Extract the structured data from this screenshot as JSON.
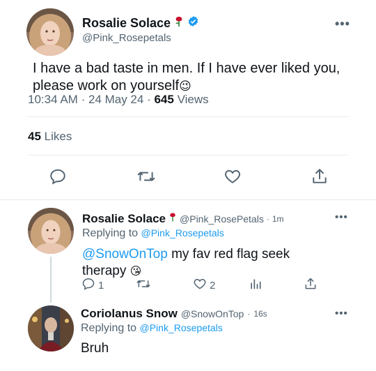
{
  "main_tweet": {
    "display_name": "Rosalie Solace",
    "handle": "@Pink_Rosepetals",
    "text": "I have a bad taste in men. If I have ever liked you, please work on yourself",
    "text_emoji": "😉",
    "time": "10:34 AM",
    "date": "24 May 24",
    "views_count": "645",
    "views_label": "Views",
    "likes_count": "45",
    "likes_label": "Likes",
    "more": "•••"
  },
  "reply_1": {
    "display_name": "Rosalie Solace",
    "handle": "@Pink_RosePetals",
    "age": "1m",
    "replying_prefix": "Replying to",
    "replying_to": "@Pink_Rosepetals",
    "mention": "@SnowOnTop",
    "text": "my fav red flag seek therapy",
    "text_emoji": "😘",
    "reply_count": "1",
    "like_count": "2",
    "more": "•••"
  },
  "reply_2": {
    "display_name": "Coriolanus Snow",
    "handle": "@SnowOnTop",
    "age": "16s",
    "replying_prefix": "Replying to",
    "replying_to": "@Pink_Rosepetals",
    "text": "Bruh",
    "more": "•••"
  },
  "colors": {
    "accent": "#1d9bf0",
    "secondary_text": "#536471",
    "rose": "#c8102e"
  },
  "icons": {
    "reply": "reply-icon",
    "retweet": "retweet-icon",
    "like": "heart-icon",
    "share": "share-icon",
    "analytics": "analytics-icon",
    "verified": "verified-badge-icon",
    "rose": "rose-icon"
  }
}
